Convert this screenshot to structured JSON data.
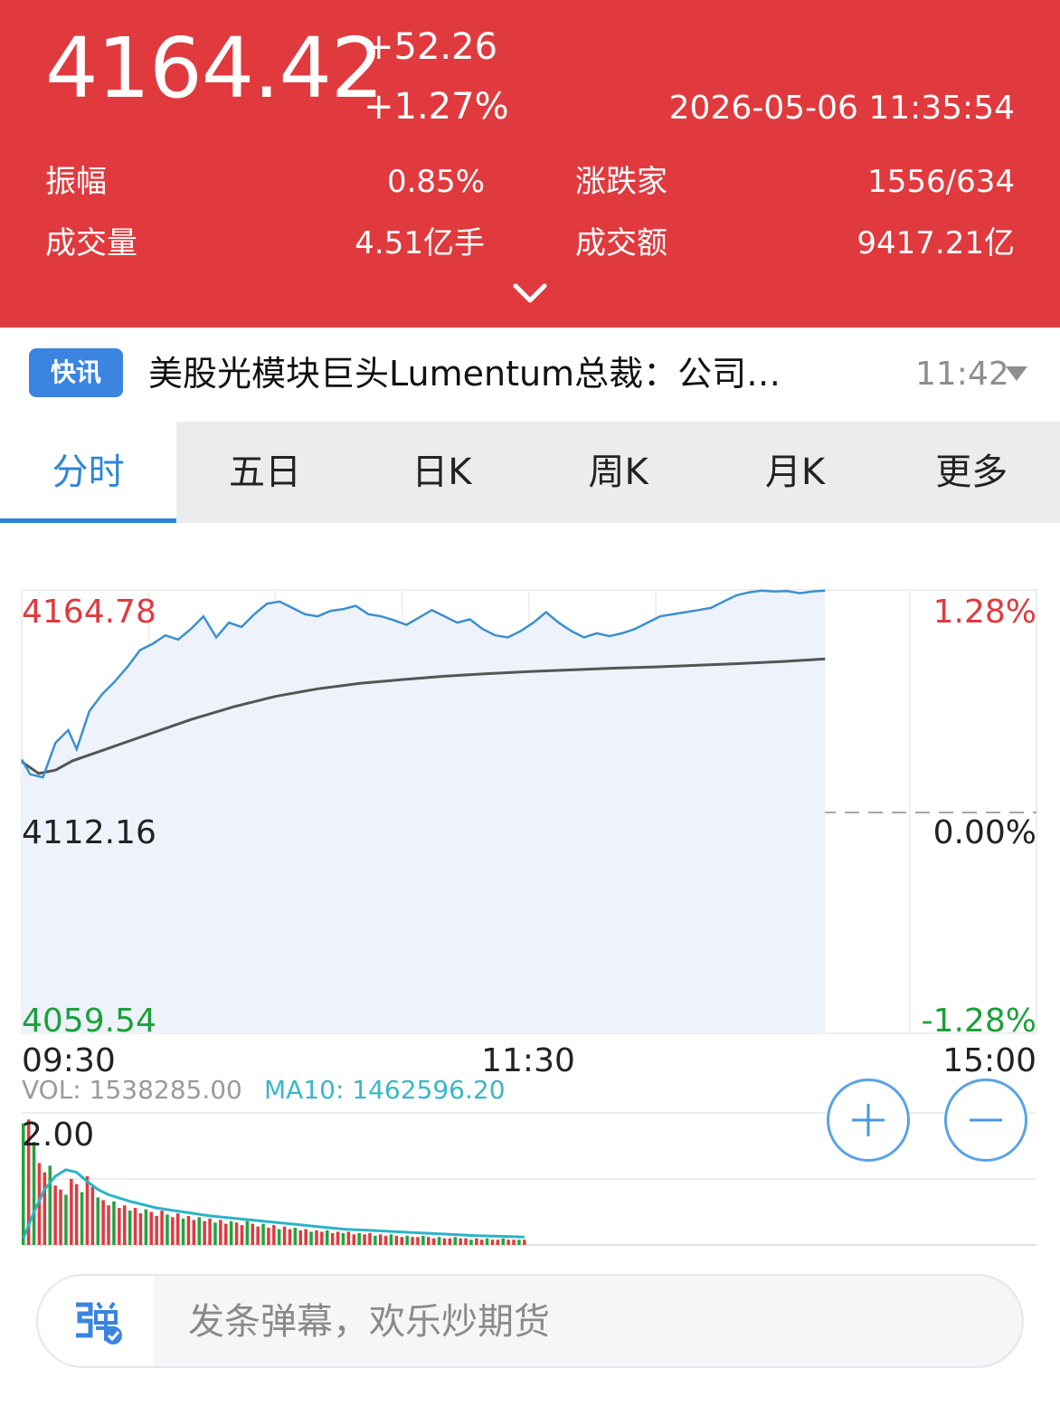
{
  "quote": {
    "price": "4164.42",
    "change": "+52.26",
    "change_pct": "+1.27%",
    "datetime": "2026-05-06 11:35:54",
    "stats": [
      {
        "label": "振幅",
        "value": "0.85%"
      },
      {
        "label": "涨跌家",
        "value": "1556/634"
      },
      {
        "label": "成交量",
        "value": "4.51亿手"
      },
      {
        "label": "成交额",
        "value": "9417.21亿"
      }
    ],
    "expand_icon": "chevron-down-icon",
    "bg_color": "#e03a3e"
  },
  "news": {
    "badge": "快讯",
    "headline": "美股光模块巨头Lumentum总裁：公司…",
    "time": "11:42"
  },
  "tabs": [
    {
      "label": "分时",
      "active": true
    },
    {
      "label": "五日",
      "active": false
    },
    {
      "label": "日K",
      "active": false
    },
    {
      "label": "周K",
      "active": false
    },
    {
      "label": "月K",
      "active": false
    },
    {
      "label": "更多",
      "active": false
    }
  ],
  "chart_data": {
    "type": "line",
    "price_axis": {
      "top": "4164.78",
      "mid": "4112.16",
      "bottom": "4059.54"
    },
    "pct_axis": {
      "top": "1.28%",
      "mid": "0.00%",
      "bottom": "-1.28%"
    },
    "ylim": [
      4059.54,
      4164.78
    ],
    "prev_close": 4112.16,
    "time_labels": [
      "09:30",
      "11:30",
      "15:00"
    ],
    "total_minutes": 240,
    "price_series": [
      [
        0,
        4124.5
      ],
      [
        2,
        4121.0
      ],
      [
        5,
        4120.3
      ],
      [
        8,
        4128.5
      ],
      [
        11,
        4131.5
      ],
      [
        13,
        4127.0
      ],
      [
        16,
        4136.0
      ],
      [
        19,
        4140.0
      ],
      [
        22,
        4143.0
      ],
      [
        25,
        4146.5
      ],
      [
        28,
        4150.5
      ],
      [
        31,
        4152.0
      ],
      [
        34,
        4154.0
      ],
      [
        37,
        4153.0
      ],
      [
        40,
        4155.5
      ],
      [
        43,
        4158.5
      ],
      [
        46,
        4153.5
      ],
      [
        49,
        4157.0
      ],
      [
        52,
        4156.0
      ],
      [
        55,
        4159.0
      ],
      [
        58,
        4161.5
      ],
      [
        61,
        4162.0
      ],
      [
        64,
        4160.5
      ],
      [
        67,
        4159.0
      ],
      [
        70,
        4158.5
      ],
      [
        73,
        4159.8
      ],
      [
        76,
        4160.2
      ],
      [
        79,
        4161.0
      ],
      [
        82,
        4159.0
      ],
      [
        85,
        4158.5
      ],
      [
        88,
        4157.6
      ],
      [
        91,
        4156.5
      ],
      [
        94,
        4158.2
      ],
      [
        97,
        4160.0
      ],
      [
        100,
        4158.5
      ],
      [
        103,
        4157.0
      ],
      [
        106,
        4157.8
      ],
      [
        109,
        4155.5
      ],
      [
        112,
        4154.0
      ],
      [
        115,
        4153.5
      ],
      [
        118,
        4155.0
      ],
      [
        121,
        4157.0
      ],
      [
        124,
        4159.5
      ],
      [
        127,
        4157.0
      ],
      [
        130,
        4155.0
      ],
      [
        133,
        4153.5
      ],
      [
        136,
        4154.5
      ],
      [
        139,
        4153.8
      ],
      [
        142,
        4154.5
      ],
      [
        145,
        4155.5
      ],
      [
        148,
        4157.0
      ],
      [
        151,
        4158.5
      ],
      [
        154,
        4159.0
      ],
      [
        157,
        4159.5
      ],
      [
        160,
        4160.0
      ],
      [
        163,
        4160.5
      ],
      [
        166,
        4162.0
      ],
      [
        169,
        4163.5
      ],
      [
        172,
        4164.2
      ],
      [
        175,
        4164.6
      ],
      [
        178,
        4164.4
      ],
      [
        181,
        4164.5
      ],
      [
        184,
        4164.0
      ],
      [
        187,
        4164.4
      ],
      [
        190,
        4164.6
      ]
    ],
    "avg_series": [
      [
        0,
        4124.0
      ],
      [
        4,
        4121.2
      ],
      [
        8,
        4122.0
      ],
      [
        12,
        4124.2
      ],
      [
        20,
        4127.0
      ],
      [
        30,
        4130.5
      ],
      [
        40,
        4134.0
      ],
      [
        50,
        4137.0
      ],
      [
        60,
        4139.5
      ],
      [
        70,
        4141.3
      ],
      [
        80,
        4142.6
      ],
      [
        90,
        4143.5
      ],
      [
        100,
        4144.3
      ],
      [
        110,
        4144.9
      ],
      [
        120,
        4145.4
      ],
      [
        130,
        4145.8
      ],
      [
        140,
        4146.2
      ],
      [
        150,
        4146.5
      ],
      [
        160,
        4146.9
      ],
      [
        170,
        4147.3
      ],
      [
        180,
        4147.8
      ],
      [
        190,
        4148.4
      ]
    ],
    "volume": {
      "label_vol": "VOL: 1538285.00",
      "label_ma": "MA10: 1462596.20",
      "axis_top": "2.00",
      "bars": [
        [
          0,
          0.92,
          "g"
        ],
        [
          1,
          0.95,
          "r"
        ],
        [
          2,
          0.78,
          "g"
        ],
        [
          3,
          0.62,
          "r"
        ],
        [
          4,
          0.55,
          "r"
        ],
        [
          5,
          0.6,
          "g"
        ],
        [
          6,
          0.45,
          "r"
        ],
        [
          7,
          0.42,
          "r"
        ],
        [
          8,
          0.38,
          "g"
        ],
        [
          9,
          0.5,
          "r"
        ],
        [
          10,
          0.46,
          "r"
        ],
        [
          11,
          0.4,
          "g"
        ],
        [
          12,
          0.52,
          "r"
        ],
        [
          13,
          0.44,
          "r"
        ],
        [
          14,
          0.36,
          "g"
        ],
        [
          15,
          0.34,
          "r"
        ],
        [
          16,
          0.3,
          "r"
        ],
        [
          17,
          0.33,
          "g"
        ],
        [
          18,
          0.28,
          "r"
        ],
        [
          19,
          0.3,
          "r"
        ],
        [
          20,
          0.26,
          "g"
        ],
        [
          21,
          0.28,
          "r"
        ],
        [
          22,
          0.24,
          "r"
        ],
        [
          23,
          0.27,
          "g"
        ],
        [
          24,
          0.25,
          "r"
        ],
        [
          25,
          0.22,
          "r"
        ],
        [
          26,
          0.26,
          "r"
        ],
        [
          27,
          0.23,
          "g"
        ],
        [
          28,
          0.21,
          "r"
        ],
        [
          29,
          0.24,
          "r"
        ],
        [
          30,
          0.2,
          "g"
        ],
        [
          31,
          0.22,
          "r"
        ],
        [
          32,
          0.19,
          "r"
        ],
        [
          33,
          0.21,
          "g"
        ],
        [
          34,
          0.18,
          "r"
        ],
        [
          35,
          0.2,
          "r"
        ],
        [
          36,
          0.17,
          "g"
        ],
        [
          37,
          0.19,
          "r"
        ],
        [
          38,
          0.16,
          "r"
        ],
        [
          39,
          0.18,
          "g"
        ],
        [
          40,
          0.17,
          "r"
        ],
        [
          41,
          0.15,
          "r"
        ],
        [
          42,
          0.18,
          "g"
        ],
        [
          43,
          0.16,
          "r"
        ],
        [
          44,
          0.14,
          "r"
        ],
        [
          45,
          0.16,
          "g"
        ],
        [
          46,
          0.13,
          "r"
        ],
        [
          47,
          0.15,
          "r"
        ],
        [
          48,
          0.12,
          "g"
        ],
        [
          49,
          0.14,
          "r"
        ],
        [
          50,
          0.12,
          "r"
        ],
        [
          51,
          0.13,
          "g"
        ],
        [
          52,
          0.11,
          "r"
        ],
        [
          53,
          0.12,
          "r"
        ],
        [
          54,
          0.1,
          "g"
        ],
        [
          55,
          0.11,
          "r"
        ],
        [
          56,
          0.1,
          "r"
        ],
        [
          57,
          0.11,
          "g"
        ],
        [
          58,
          0.09,
          "r"
        ],
        [
          59,
          0.1,
          "r"
        ],
        [
          60,
          0.09,
          "g"
        ],
        [
          61,
          0.1,
          "r"
        ],
        [
          62,
          0.08,
          "r"
        ],
        [
          63,
          0.09,
          "g"
        ],
        [
          64,
          0.08,
          "r"
        ],
        [
          65,
          0.09,
          "r"
        ],
        [
          66,
          0.07,
          "g"
        ],
        [
          67,
          0.08,
          "r"
        ],
        [
          68,
          0.07,
          "r"
        ],
        [
          69,
          0.08,
          "g"
        ],
        [
          70,
          0.07,
          "r"
        ],
        [
          71,
          0.06,
          "r"
        ],
        [
          72,
          0.07,
          "g"
        ],
        [
          73,
          0.06,
          "r"
        ],
        [
          74,
          0.06,
          "r"
        ],
        [
          75,
          0.07,
          "g"
        ],
        [
          76,
          0.06,
          "r"
        ],
        [
          77,
          0.05,
          "r"
        ],
        [
          78,
          0.06,
          "g"
        ],
        [
          79,
          0.05,
          "r"
        ],
        [
          80,
          0.05,
          "r"
        ],
        [
          81,
          0.06,
          "g"
        ],
        [
          82,
          0.05,
          "r"
        ],
        [
          83,
          0.05,
          "r"
        ],
        [
          84,
          0.04,
          "g"
        ],
        [
          85,
          0.05,
          "r"
        ],
        [
          86,
          0.04,
          "r"
        ],
        [
          87,
          0.05,
          "g"
        ],
        [
          88,
          0.04,
          "r"
        ],
        [
          89,
          0.04,
          "r"
        ],
        [
          90,
          0.05,
          "g"
        ],
        [
          91,
          0.04,
          "r"
        ],
        [
          92,
          0.04,
          "r"
        ],
        [
          93,
          0.04,
          "g"
        ],
        [
          94,
          0.04,
          "r"
        ]
      ],
      "ma_series": [
        [
          0,
          0.05
        ],
        [
          2,
          0.25
        ],
        [
          4,
          0.42
        ],
        [
          6,
          0.52
        ],
        [
          8,
          0.57
        ],
        [
          10,
          0.55
        ],
        [
          12,
          0.48
        ],
        [
          14,
          0.42
        ],
        [
          16,
          0.38
        ],
        [
          20,
          0.33
        ],
        [
          25,
          0.28
        ],
        [
          30,
          0.25
        ],
        [
          35,
          0.22
        ],
        [
          40,
          0.2
        ],
        [
          45,
          0.18
        ],
        [
          50,
          0.16
        ],
        [
          55,
          0.14
        ],
        [
          60,
          0.12
        ],
        [
          65,
          0.11
        ],
        [
          70,
          0.1
        ],
        [
          75,
          0.09
        ],
        [
          80,
          0.08
        ],
        [
          85,
          0.07
        ],
        [
          90,
          0.065
        ],
        [
          94,
          0.06
        ]
      ]
    }
  },
  "zoom": {
    "in_icon": "plus-circle-icon",
    "out_icon": "minus-circle-icon"
  },
  "danmaku": {
    "icon": "danmaku-icon",
    "placeholder": "发条弹幕，欢乐炒期货"
  }
}
